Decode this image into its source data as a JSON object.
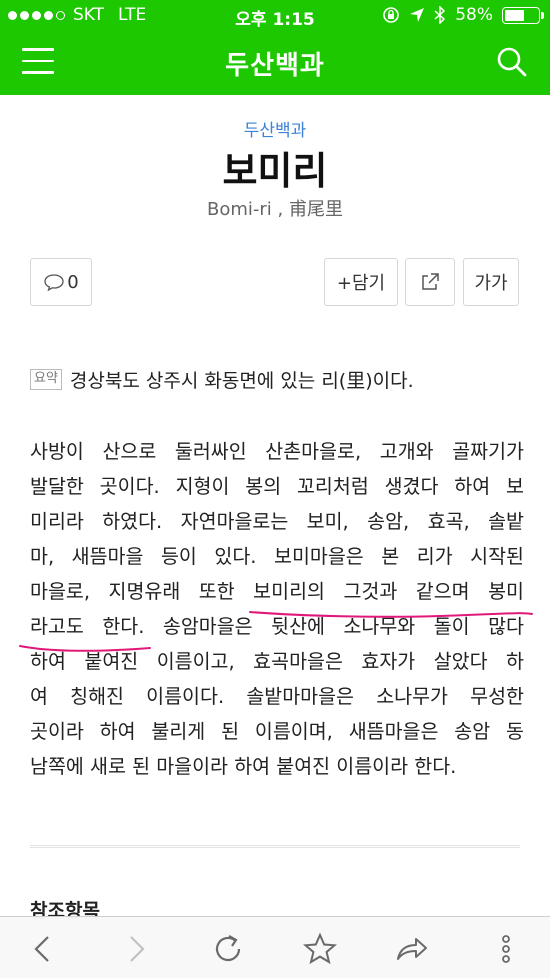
{
  "status_bar": {
    "carrier": "SKT",
    "network": "LTE",
    "time": "오후 1:15",
    "battery": "58%",
    "battery_level": 0.58
  },
  "header": {
    "title": "두산백과"
  },
  "entry": {
    "category": "두산백과",
    "title": "보미리",
    "subtitle": "Bomi-ri , 甫尾里"
  },
  "actions": {
    "comment_count": "0",
    "save_label": "+담기",
    "font_label": "가가"
  },
  "summary": {
    "tag": "요약",
    "text": "경상북도 상주시 화동면에 있는 리(里)이다."
  },
  "body_lines": [
    "사방이 산으로 둘러싸인 산촌마을로, 고개와 골짜기가",
    "발달한 곳이다. 지형이 봉의 꼬리처럼 생겼다 하여 보",
    "미리라 하였다. 자연마을로는 보미, 송암, 효곡, 솔밭",
    "마, 새뜸마을 등이 있다. 보미마을은 본 리가 시작된",
    "마을로, 지명유래 또한 보미리의 그것과 같으며 봉미",
    "라고도 한다. 송암마을은 뒷산에 소나무와 돌이 많다",
    "하여 붙여진 이름이고, 효곡마을은 효자가 살았다 하",
    "여 칭해진 이름이다. 솔밭마마을은 소나무가 무성한",
    "곳이라 하여 불리게 된 이름이며, 새뜸마을은 송암 동",
    "남쪽에 새로 된 마을이라 하여 붙여진 이름이라 한다."
  ],
  "references": {
    "title": "참조항목"
  },
  "colors": {
    "brand_green": "#1ec800",
    "category_blue": "#3c83d8",
    "annotation_pink": "#e0187a"
  },
  "icons": {
    "menu": "hamburger-menu-icon",
    "search": "search-icon",
    "comment": "speech-bubble-icon",
    "share": "share-icon",
    "back": "chevron-left-icon",
    "forward": "chevron-right-icon",
    "reload": "reload-icon",
    "bookmark": "star-icon",
    "toolbar_share": "arrow-share-icon",
    "more": "more-vertical-icon"
  }
}
